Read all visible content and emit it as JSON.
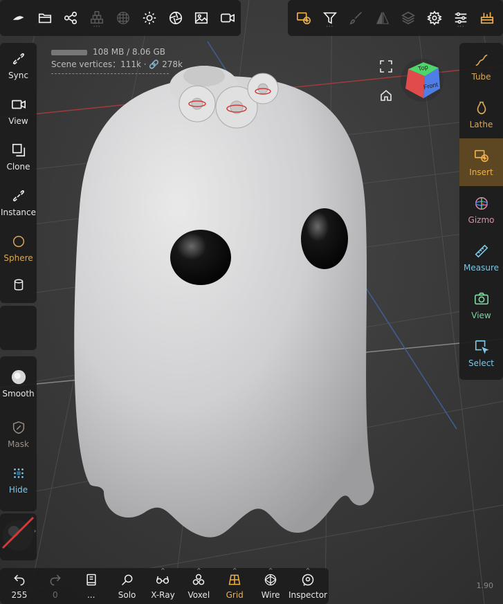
{
  "stats": {
    "memory": "108 MB / 8.06 GB",
    "vertices_label": "Scene vertices：111k · 🔗 278k"
  },
  "topbar_left": [
    {
      "icon": "cloud-logo-icon"
    },
    {
      "icon": "folder-icon"
    },
    {
      "icon": "share-nodes-icon"
    },
    {
      "icon": "stack-blocks-icon",
      "disabled": true
    },
    {
      "icon": "sphere-grid-icon",
      "disabled": true
    },
    {
      "icon": "sun-icon"
    },
    {
      "icon": "aperture-icon"
    },
    {
      "icon": "image-icon"
    },
    {
      "icon": "video-icon"
    }
  ],
  "topbar_right": [
    {
      "icon": "insert-tool-icon",
      "active": true
    },
    {
      "icon": "filter-icon"
    },
    {
      "icon": "brush-icon",
      "disabled": true
    },
    {
      "icon": "symmetry-icon",
      "disabled": true
    },
    {
      "icon": "layers-icon",
      "disabled": true
    },
    {
      "icon": "gear-icon"
    },
    {
      "icon": "sliders-icon"
    },
    {
      "icon": "toolbox-icon",
      "accent": true
    }
  ],
  "left_tools": [
    {
      "label": "Sync",
      "icon": "link-icon"
    },
    {
      "label": "View",
      "icon": "camera-icon"
    },
    {
      "label": "Clone",
      "icon": "clone-icon"
    },
    {
      "label": "Instance",
      "icon": "link-icon"
    },
    {
      "label": "Sphere",
      "icon": "circle-icon",
      "color": "gold"
    },
    {
      "label": "",
      "icon": "cylinder-icon"
    }
  ],
  "left_tools_bottom": [
    {
      "label": "Smooth",
      "icon": "smooth-brush-icon"
    },
    {
      "label": "Mask",
      "icon": "mask-icon",
      "color": "dim"
    },
    {
      "label": "Hide",
      "icon": "hide-pattern-icon",
      "color": "cyan"
    }
  ],
  "right_tools": [
    {
      "label": "Tube",
      "icon": "tube-curve-icon",
      "color": "gold"
    },
    {
      "label": "Lathe",
      "icon": "vase-icon",
      "color": "gold"
    },
    {
      "label": "Insert",
      "icon": "insert-tool-icon",
      "active": true
    },
    {
      "label": "Gizmo",
      "icon": "gizmo-icon",
      "color": "pink"
    },
    {
      "label": "Measure",
      "icon": "ruler-icon",
      "color": "cyan"
    },
    {
      "label": "View",
      "icon": "camera-icon",
      "color": "green"
    },
    {
      "label": "Select",
      "icon": "select-box-icon",
      "color": "cyan"
    }
  ],
  "bottom_tools": [
    {
      "label": "255",
      "icon": "undo-icon"
    },
    {
      "label": "0",
      "icon": "redo-icon",
      "disabled": true
    },
    {
      "label": "...",
      "icon": "book-icon"
    },
    {
      "label": "Solo",
      "icon": "search-icon"
    },
    {
      "label": "X-Ray",
      "icon": "glasses-icon",
      "caret": true
    },
    {
      "label": "Voxel",
      "icon": "voxel-icon",
      "caret": true
    },
    {
      "label": "Grid",
      "icon": "grid-icon",
      "active": true,
      "caret": true
    },
    {
      "label": "Wire",
      "icon": "wire-icon",
      "caret": true
    },
    {
      "label": "Inspector",
      "icon": "eye-icon",
      "caret": true
    }
  ],
  "viewcube": {
    "top": "Top",
    "front": "Front"
  },
  "version": "1.90",
  "colors": {
    "accent": "#f0b04d",
    "panel": "#1c1c1c"
  }
}
